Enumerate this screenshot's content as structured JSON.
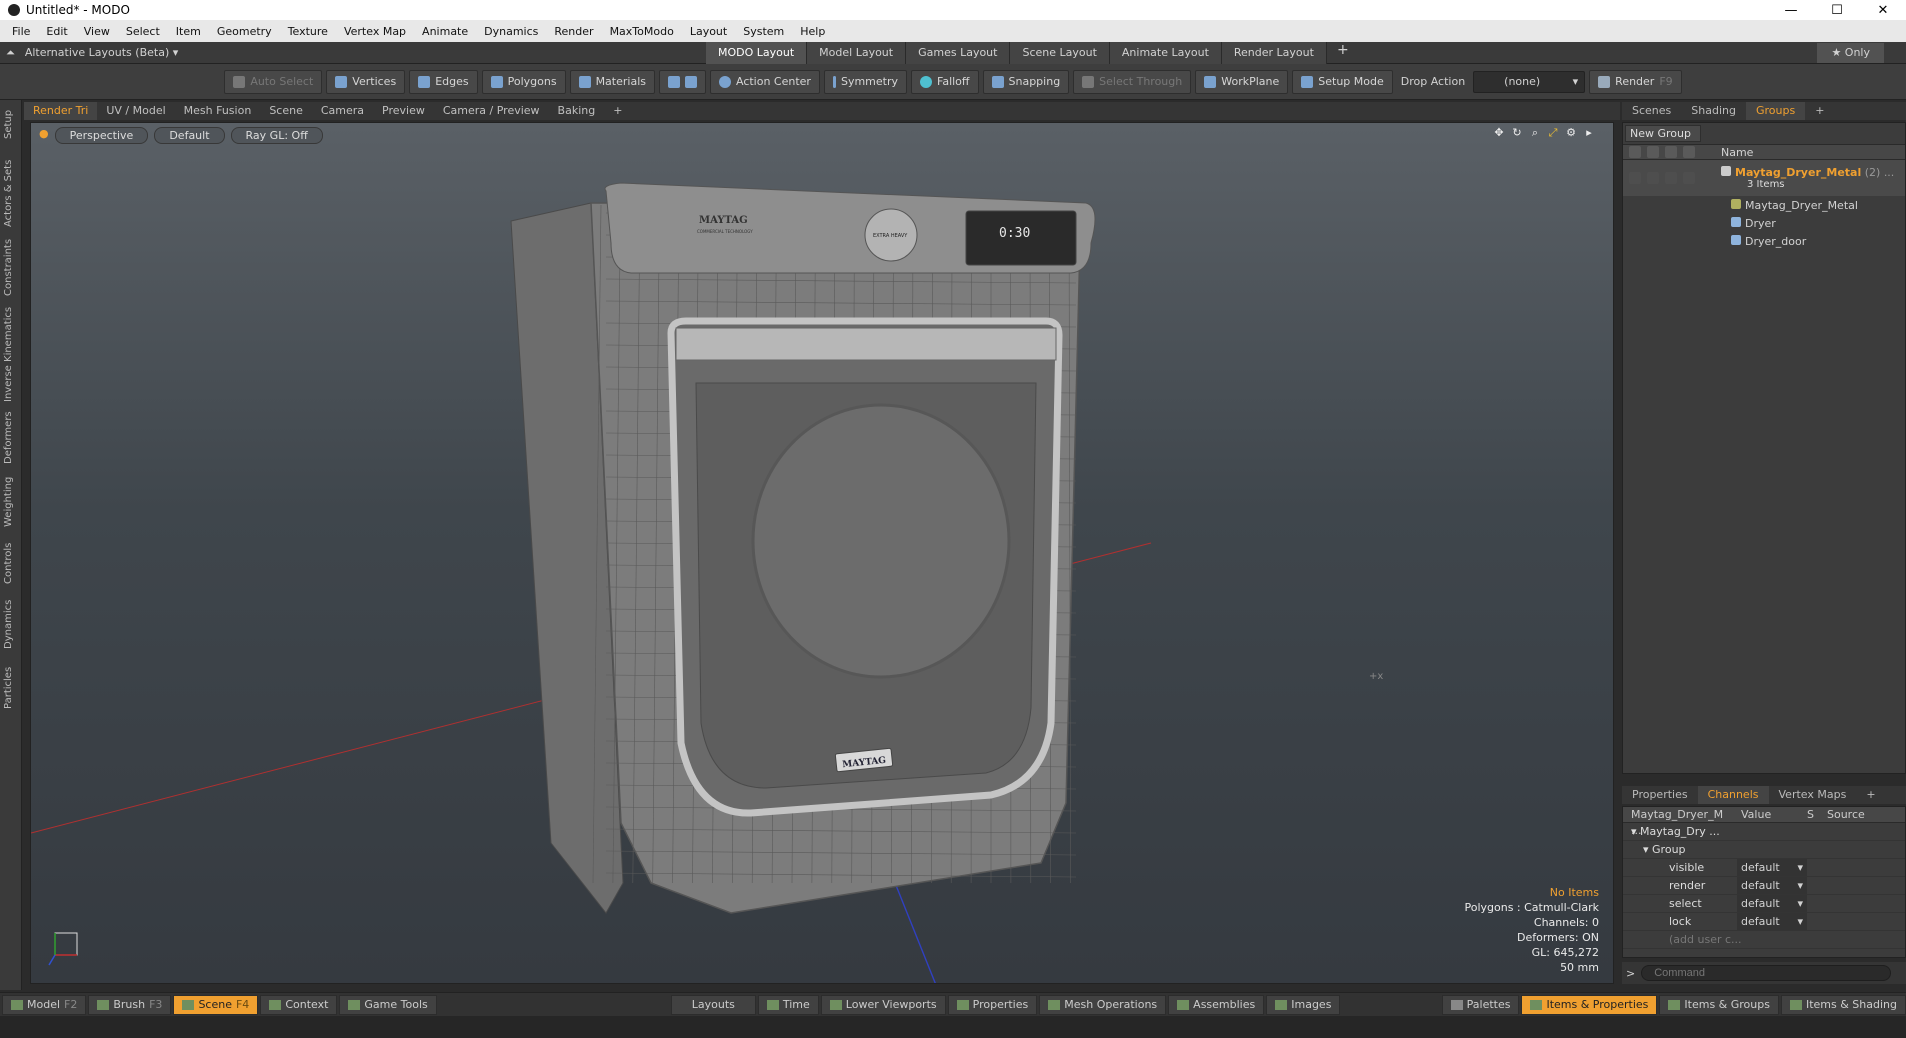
{
  "window": {
    "title": "Untitled* - MODO",
    "controls": [
      "—",
      "☐",
      "✕"
    ]
  },
  "menu": [
    "File",
    "Edit",
    "View",
    "Select",
    "Item",
    "Geometry",
    "Texture",
    "Vertex Map",
    "Animate",
    "Dynamics",
    "Render",
    "MaxToModo",
    "Layout",
    "System",
    "Help"
  ],
  "layout_bar": {
    "alt_layouts": "Alternative Layouts (Beta) ▾",
    "tabs": [
      "MODO Layout",
      "Model Layout",
      "Games Layout",
      "Scene Layout",
      "Animate Layout",
      "Render Layout"
    ],
    "active_tab": "MODO Layout",
    "only": "★ Only"
  },
  "toolbar": {
    "auto_select": "Auto Select",
    "vertices": "Vertices",
    "edges": "Edges",
    "polygons": "Polygons",
    "materials": "Materials",
    "action_center": "Action Center",
    "symmetry": "Symmetry",
    "falloff": "Falloff",
    "snapping": "Snapping",
    "select_through": "Select Through",
    "workplane": "WorkPlane",
    "setup_mode": "Setup Mode",
    "drop_action": "Drop Action",
    "drop_value": "(none)",
    "render": "Render",
    "render_key": "F9"
  },
  "left_tabs": [
    "Setup",
    "Actors & Sets",
    "Constraints",
    "Inverse Kinematics",
    "Deformers",
    "Weighting",
    "Controls",
    "Dynamics",
    "Particles"
  ],
  "viewport_tabs": [
    "Render Tri",
    "UV / Model",
    "Mesh Fusion",
    "Scene",
    "Camera",
    "Preview",
    "Camera / Preview",
    "Baking",
    "+"
  ],
  "viewport": {
    "view": "Perspective",
    "shading": "Default",
    "raygl": "Ray GL: Off",
    "info": {
      "no_items": "No Items",
      "polygons": "Polygons : Catmull-Clark",
      "channels": "Channels: 0",
      "deformers": "Deformers: ON",
      "gl": "GL: 645,272",
      "focal": "50 mm"
    },
    "dryer_brand": "MAYTAG",
    "dryer_brand_small": "COMMERCIAL TECHNOLOGY",
    "display_time": "0:30",
    "knob_label": "EXTRA HEAVY"
  },
  "right_tabs": [
    "Scenes",
    "Shading",
    "Groups",
    "+"
  ],
  "right_active": "Groups",
  "groups": {
    "new_group": "New Group",
    "name_col": "Name",
    "group_name": "Maytag_Dryer_Metal",
    "group_count": "(2) ...",
    "group_items": "3 Items",
    "children": [
      "Maytag_Dryer_Metal",
      "Dryer",
      "Dryer_door"
    ]
  },
  "bottom_tabs": [
    "Properties",
    "Channels",
    "Vertex Maps",
    "+"
  ],
  "bottom_active": "Channels",
  "channels": {
    "col_item": "Maytag_Dryer_M ...",
    "col_value": "Value",
    "col_s": "S",
    "col_source": "Source",
    "root": "Maytag_Dry ...",
    "group": "Group",
    "rows": [
      {
        "name": "visible",
        "value": "default"
      },
      {
        "name": "render",
        "value": "default"
      },
      {
        "name": "select",
        "value": "default"
      },
      {
        "name": "lock",
        "value": "default"
      }
    ],
    "add_user": "(add user c..."
  },
  "command_placeholder": "Command",
  "statusbar": {
    "left": [
      {
        "label": "Model",
        "key": "F2"
      },
      {
        "label": "Brush",
        "key": "F3"
      },
      {
        "label": "Scene",
        "key": "F4",
        "active": true
      },
      {
        "label": "Context",
        "key": ""
      },
      {
        "label": "Game Tools",
        "key": ""
      }
    ],
    "middle": [
      "Layouts",
      "Time",
      "Lower Viewports",
      "Properties",
      "Mesh Operations",
      "Assemblies",
      "Images"
    ],
    "right": [
      "Palettes",
      "Items & Properties",
      "Items & Groups",
      "Items & Shading"
    ],
    "right_active": "Items & Properties"
  },
  "colors": {
    "accent": "#f0a030",
    "grid_x": "#c03030",
    "grid_z": "#3040c0"
  }
}
